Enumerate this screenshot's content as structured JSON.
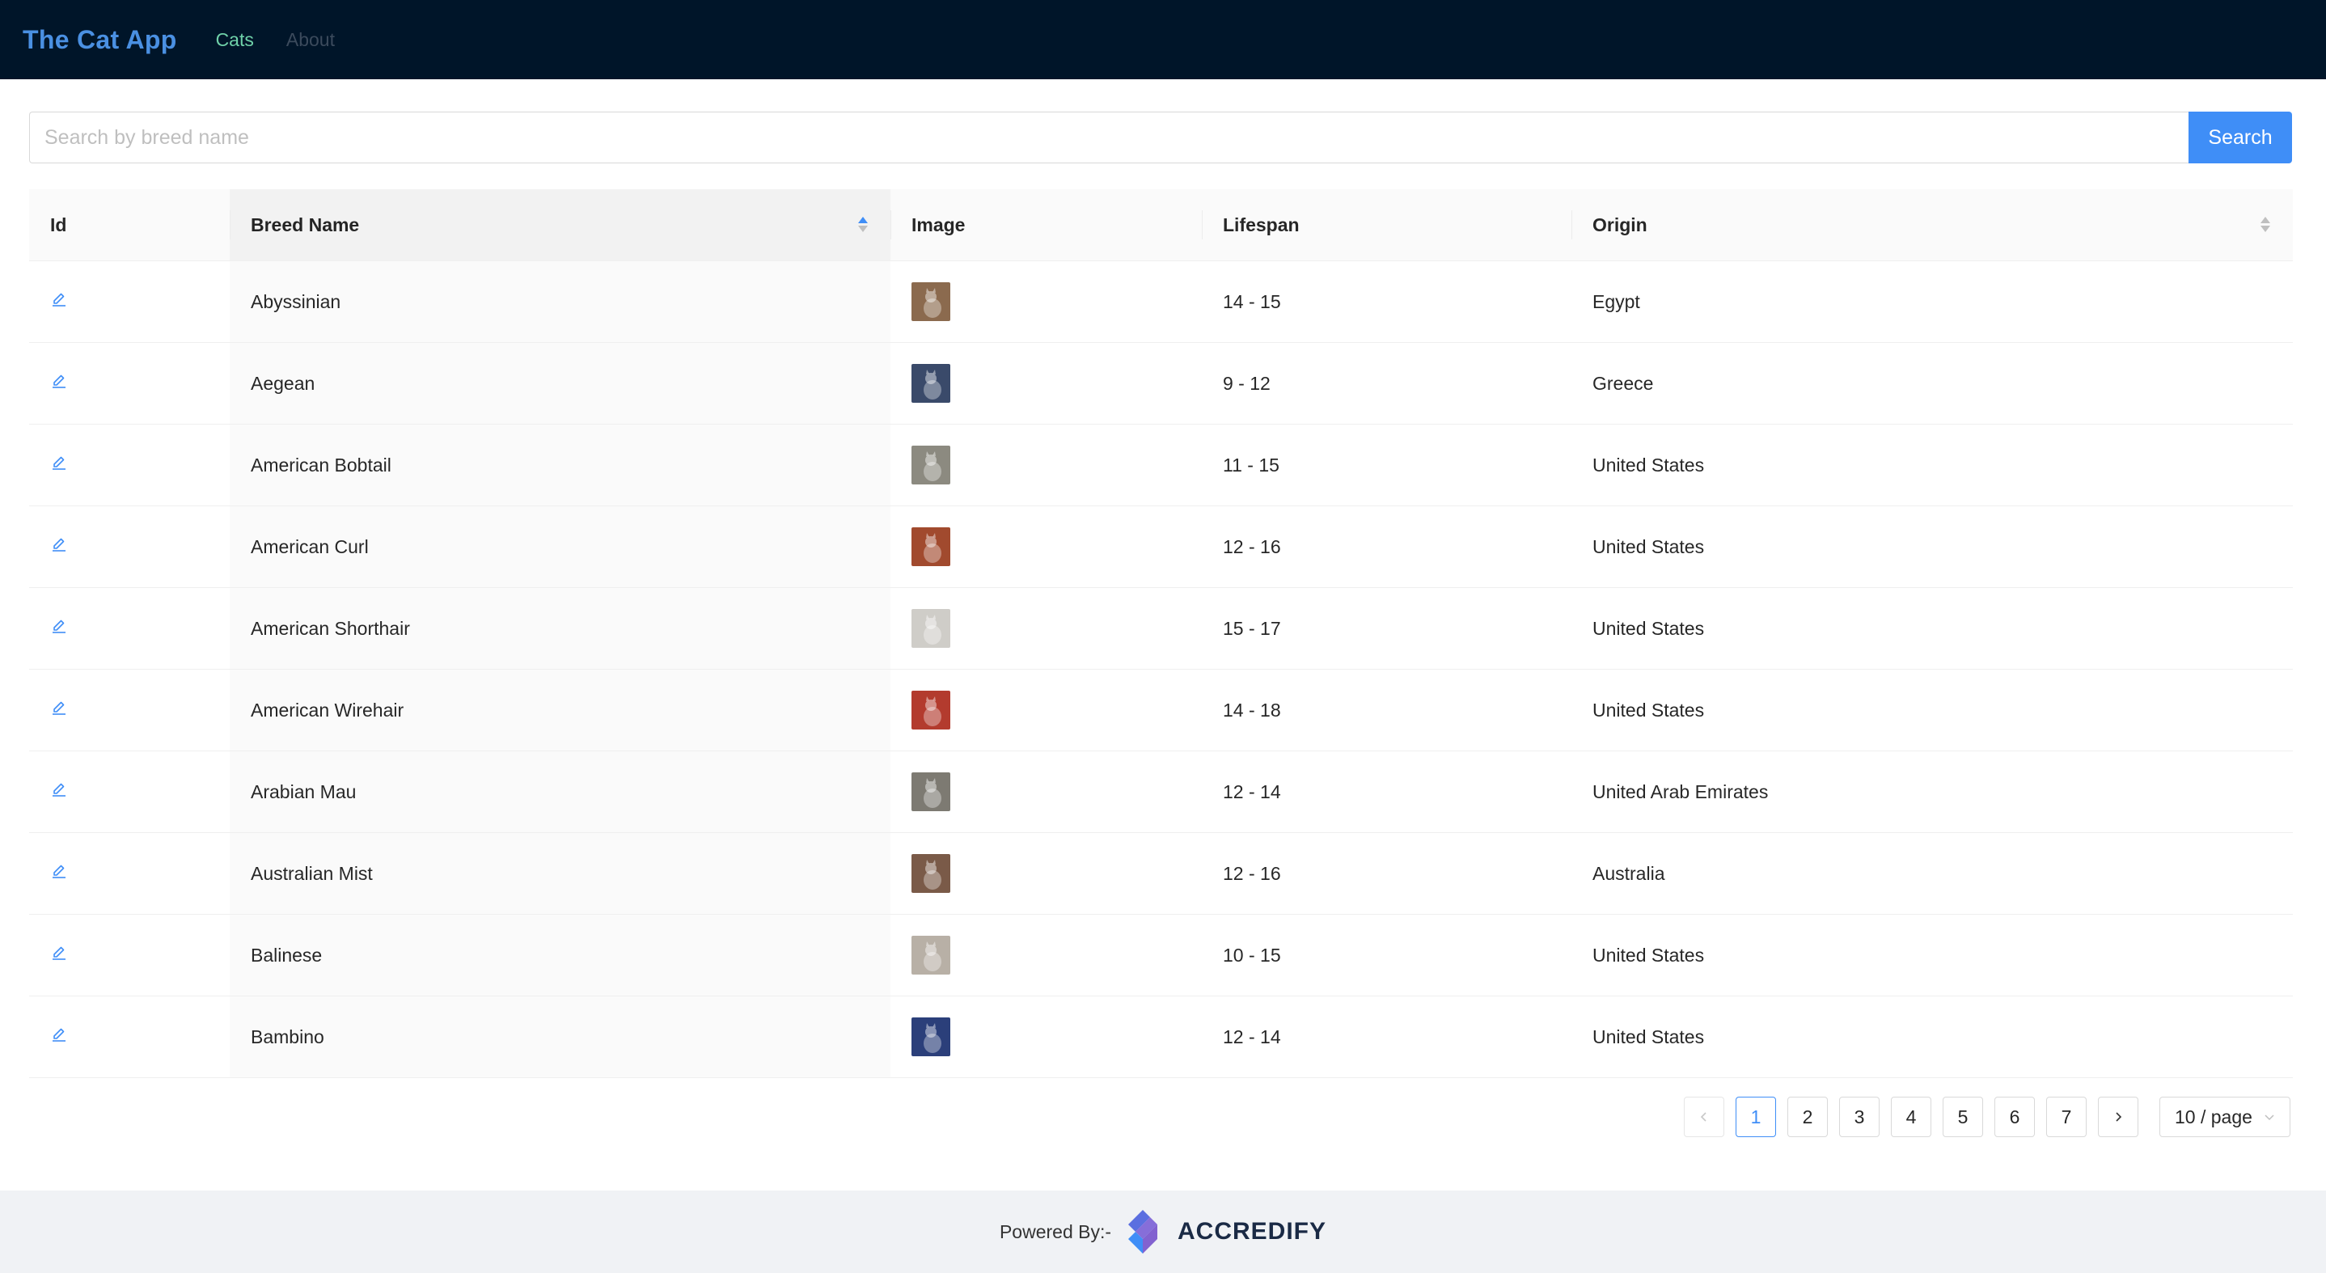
{
  "header": {
    "brand": "The Cat App",
    "nav": [
      {
        "label": "Cats",
        "active": true
      },
      {
        "label": "About",
        "active": false
      }
    ]
  },
  "search": {
    "placeholder": "Search by breed name",
    "value": "",
    "button_label": "Search"
  },
  "table": {
    "columns": [
      "Id",
      "Breed Name",
      "Image",
      "Lifespan",
      "Origin"
    ],
    "sort": {
      "column": "Breed Name",
      "direction": "ascending"
    },
    "rows": [
      {
        "breed": "Abyssinian",
        "lifespan": "14 - 15",
        "origin": "Egypt",
        "thumb": "#8b6a4e"
      },
      {
        "breed": "Aegean",
        "lifespan": "9 - 12",
        "origin": "Greece",
        "thumb": "#3a4a6a"
      },
      {
        "breed": "American Bobtail",
        "lifespan": "11 - 15",
        "origin": "United States",
        "thumb": "#8c8a80"
      },
      {
        "breed": "American Curl",
        "lifespan": "12 - 16",
        "origin": "United States",
        "thumb": "#a14a2e"
      },
      {
        "breed": "American Shorthair",
        "lifespan": "15 - 17",
        "origin": "United States",
        "thumb": "#cfcdc8"
      },
      {
        "breed": "American Wirehair",
        "lifespan": "14 - 18",
        "origin": "United States",
        "thumb": "#b33b2e"
      },
      {
        "breed": "Arabian Mau",
        "lifespan": "12 - 14",
        "origin": "United Arab Emirates",
        "thumb": "#7d7a72"
      },
      {
        "breed": "Australian Mist",
        "lifespan": "12 - 16",
        "origin": "Australia",
        "thumb": "#7a5a48"
      },
      {
        "breed": "Balinese",
        "lifespan": "10 - 15",
        "origin": "United States",
        "thumb": "#b8b0a6"
      },
      {
        "breed": "Bambino",
        "lifespan": "12 - 14",
        "origin": "United States",
        "thumb": "#2b3f7a"
      }
    ]
  },
  "pagination": {
    "pages": [
      "1",
      "2",
      "3",
      "4",
      "5",
      "6",
      "7"
    ],
    "current": "1",
    "page_size_label": "10 / page"
  },
  "footer": {
    "powered_by": "Powered By:-",
    "brand": "ACCREDIFY"
  },
  "colors": {
    "header_bg": "#001529",
    "brand": "#4a90e2",
    "nav_active": "#6fd1a9",
    "primary": "#3f8ef7",
    "footer_bg": "#f0f2f5"
  }
}
